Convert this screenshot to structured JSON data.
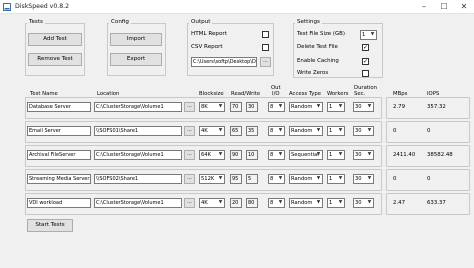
{
  "window": {
    "title": "DiskSpeed v0.8.2",
    "minimize": "–",
    "maximize": "☐",
    "close": "✕"
  },
  "test_group": {
    "label": "Tests",
    "add_test": "Add Test",
    "remove_test": "Remove Test"
  },
  "config_group": {
    "label": "Config",
    "import": "Import",
    "export": "Export"
  },
  "output_group": {
    "label": "Output",
    "html_report": "HTML Report",
    "csv_report": "CSV Report",
    "path": "C:\\Users\\softp\\Desktop\\Dis",
    "browse": "..."
  },
  "settings_group": {
    "label": "Settings",
    "test_file_size_label": "Test File Size (GB)",
    "test_file_size_value": "1",
    "delete_test_file": "Delete Test File",
    "enable_caching": "Enable Caching",
    "write_zeros": "Write Zeros",
    "delete_test_file_checked": true,
    "enable_caching_checked": true,
    "write_zeros_checked": false
  },
  "columns": {
    "test_name": "Test Name",
    "location": "Location",
    "blocksize": "Blocksize",
    "read_write": "Read/Write",
    "out_io": "Out\nI/O",
    "access_type": "Access Type",
    "workers": "Workers",
    "duration": "Duration\nSec.",
    "mbps": "MBps",
    "iops": "IOPS"
  },
  "tests": [
    {
      "name": "Database Server",
      "location": "C:\\ClusterStorage\\Volume1",
      "blocksize": "8K",
      "read": "70",
      "write": "30",
      "out_io": "8",
      "access": "Random",
      "workers": "1",
      "duration": "30",
      "mbps": "2.79",
      "iops": "357.32"
    },
    {
      "name": "Email Server",
      "location": "\\\\SOFS01\\Share1",
      "blocksize": "4K",
      "read": "65",
      "write": "35",
      "out_io": "8",
      "access": "Random",
      "workers": "1",
      "duration": "30",
      "mbps": "0",
      "iops": "0"
    },
    {
      "name": "Archival FileServer",
      "location": "C:\\ClusterStorage\\Volume1",
      "blocksize": "64K",
      "read": "90",
      "write": "10",
      "out_io": "8",
      "access": "Sequential",
      "workers": "1",
      "duration": "30",
      "mbps": "2411.40",
      "iops": "38582.48"
    },
    {
      "name": "Streaming Media Server",
      "location": "\\\\SOFS02\\Share1",
      "blocksize": "512K",
      "read": "95",
      "write": "5",
      "out_io": "8",
      "access": "Random",
      "workers": "1",
      "duration": "30",
      "mbps": "0",
      "iops": "0"
    },
    {
      "name": "VDI workload",
      "location": "C:\\ClusterStorage\\Volume1",
      "blocksize": "4K",
      "read": "20",
      "write": "80",
      "out_io": "8",
      "access": "Random",
      "workers": "1",
      "duration": "30",
      "mbps": "2.47",
      "iops": "633.37"
    }
  ],
  "browse_label": "...",
  "start_tests": "Start Tests",
  "colors": {
    "background": "#f0f0f0",
    "border": "#c9c9c9",
    "button": "#e1e1e1"
  }
}
